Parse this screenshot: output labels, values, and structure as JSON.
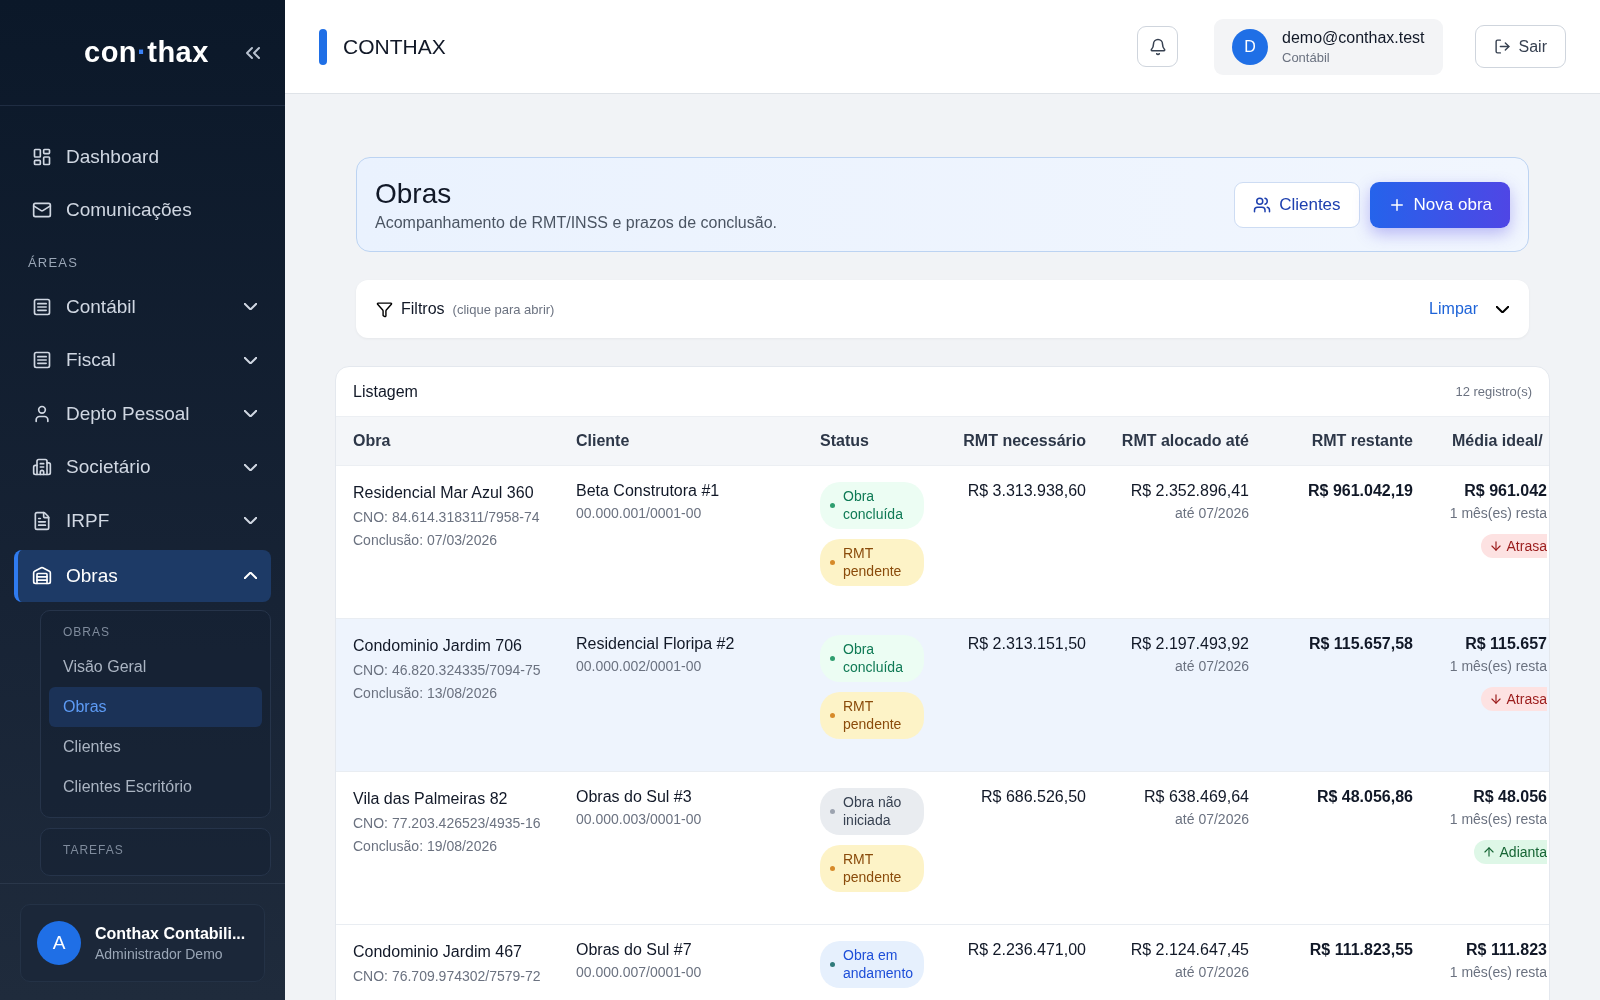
{
  "sidebar": {
    "logo": {
      "left": "con",
      "dot": "·",
      "right": "thax"
    },
    "top_items": [
      {
        "label": "Dashboard",
        "selected": false
      },
      {
        "label": "Comunicações",
        "selected": false
      }
    ],
    "section_label": "ÁREAS",
    "areas": [
      {
        "label": "Contábil",
        "expanded": false,
        "selected": false
      },
      {
        "label": "Fiscal",
        "expanded": false,
        "selected": false
      },
      {
        "label": "Depto Pessoal",
        "expanded": false,
        "selected": false
      },
      {
        "label": "Societário",
        "expanded": false,
        "selected": false
      },
      {
        "label": "IRPF",
        "expanded": false,
        "selected": false
      },
      {
        "label": "Obras",
        "expanded": true,
        "selected": true
      }
    ],
    "submenu": {
      "title": "OBRAS",
      "items": [
        {
          "label": "Visão Geral",
          "selected": false
        },
        {
          "label": "Obras",
          "selected": true
        },
        {
          "label": "Clientes",
          "selected": false
        },
        {
          "label": "Clientes Escritório",
          "selected": false
        }
      ]
    },
    "next_group": "TAREFAS",
    "user": {
      "initial": "A",
      "name": "Conthax Contabili...",
      "role": "Administrador Demo"
    }
  },
  "header": {
    "title": "CONTHAX",
    "user": {
      "initial": "D",
      "email": "demo@conthax.test",
      "role": "Contábil"
    },
    "logout": "Sair"
  },
  "hero": {
    "title": "Obras",
    "subtitle": "Acompanhamento de RMT/INSS e prazos de conclusão.",
    "buttons": [
      {
        "label": "Clientes",
        "kind": "secondary"
      },
      {
        "label": "Nova obra",
        "kind": "primary"
      }
    ]
  },
  "filters": {
    "label": "Filtros",
    "hint": "(clique para abrir)",
    "clear": "Limpar",
    "expanded": false
  },
  "table": {
    "title": "Listagem",
    "count": "12 registro(s)",
    "columns": [
      "Obra",
      "Cliente",
      "Status",
      "RMT necessário",
      "RMT alocado até",
      "RMT restante",
      "Média ideal/"
    ],
    "rows": [
      {
        "obra": "Residencial Mar Azul 360",
        "cno": "CNO: 84.614.318311/7958-74",
        "conclusao": "Conclusão: 07/03/2026",
        "cliente": "Beta Construtora #1",
        "doc": "00.000.001/0001-00",
        "statuses": [
          {
            "label": "Obra concluída",
            "kind": "done"
          },
          {
            "label": "RMT pendente",
            "kind": "pending"
          }
        ],
        "necessario": "R$ 3.313.938,60",
        "alocado": "R$ 2.352.896,41",
        "alocado_ate": "até 07/2026",
        "restante": "R$ 961.042,19",
        "media": "R$ 961.042",
        "media_note": "1 mês(es) resta",
        "trend": {
          "label": "Atrasa",
          "kind": "late"
        },
        "selected": false
      },
      {
        "obra": "Condominio Jardim 706",
        "cno": "CNO: 46.820.324335/7094-75",
        "conclusao": "Conclusão: 13/08/2026",
        "cliente": "Residencial Floripa #2",
        "doc": "00.000.002/0001-00",
        "statuses": [
          {
            "label": "Obra concluída",
            "kind": "done"
          },
          {
            "label": "RMT pendente",
            "kind": "pending"
          }
        ],
        "necessario": "R$ 2.313.151,50",
        "alocado": "R$ 2.197.493,92",
        "alocado_ate": "até 07/2026",
        "restante": "R$ 115.657,58",
        "media": "R$ 115.657",
        "media_note": "1 mês(es) resta",
        "trend": {
          "label": "Atrasa",
          "kind": "late"
        },
        "selected": true
      },
      {
        "obra": "Vila das Palmeiras 82",
        "cno": "CNO: 77.203.426523/4935-16",
        "conclusao": "Conclusão: 19/08/2026",
        "cliente": "Obras do Sul #3",
        "doc": "00.000.003/0001-00",
        "statuses": [
          {
            "label": "Obra não iniciada",
            "kind": "notstarted"
          },
          {
            "label": "RMT pendente",
            "kind": "pending"
          }
        ],
        "necessario": "R$ 686.526,50",
        "alocado": "R$ 638.469,64",
        "alocado_ate": "até 07/2026",
        "restante": "R$ 48.056,86",
        "media": "R$ 48.056",
        "media_note": "1 mês(es) resta",
        "trend": {
          "label": "Adianta",
          "kind": "ahead"
        },
        "selected": false
      },
      {
        "obra": "Condominio Jardim 467",
        "cno": "CNO: 76.709.974302/7579-72",
        "cliente": "Obras do Sul #7",
        "doc": "00.000.007/0001-00",
        "statuses": [
          {
            "label": "Obra em andamento",
            "kind": "progress"
          }
        ],
        "necessario": "R$ 2.236.471,00",
        "alocado": "R$ 2.124.647,45",
        "alocado_ate": "até 07/2026",
        "restante": "R$ 111.823,55",
        "media": "R$ 111.823",
        "media_note": "1 mês(es) resta",
        "selected": false
      }
    ]
  }
}
